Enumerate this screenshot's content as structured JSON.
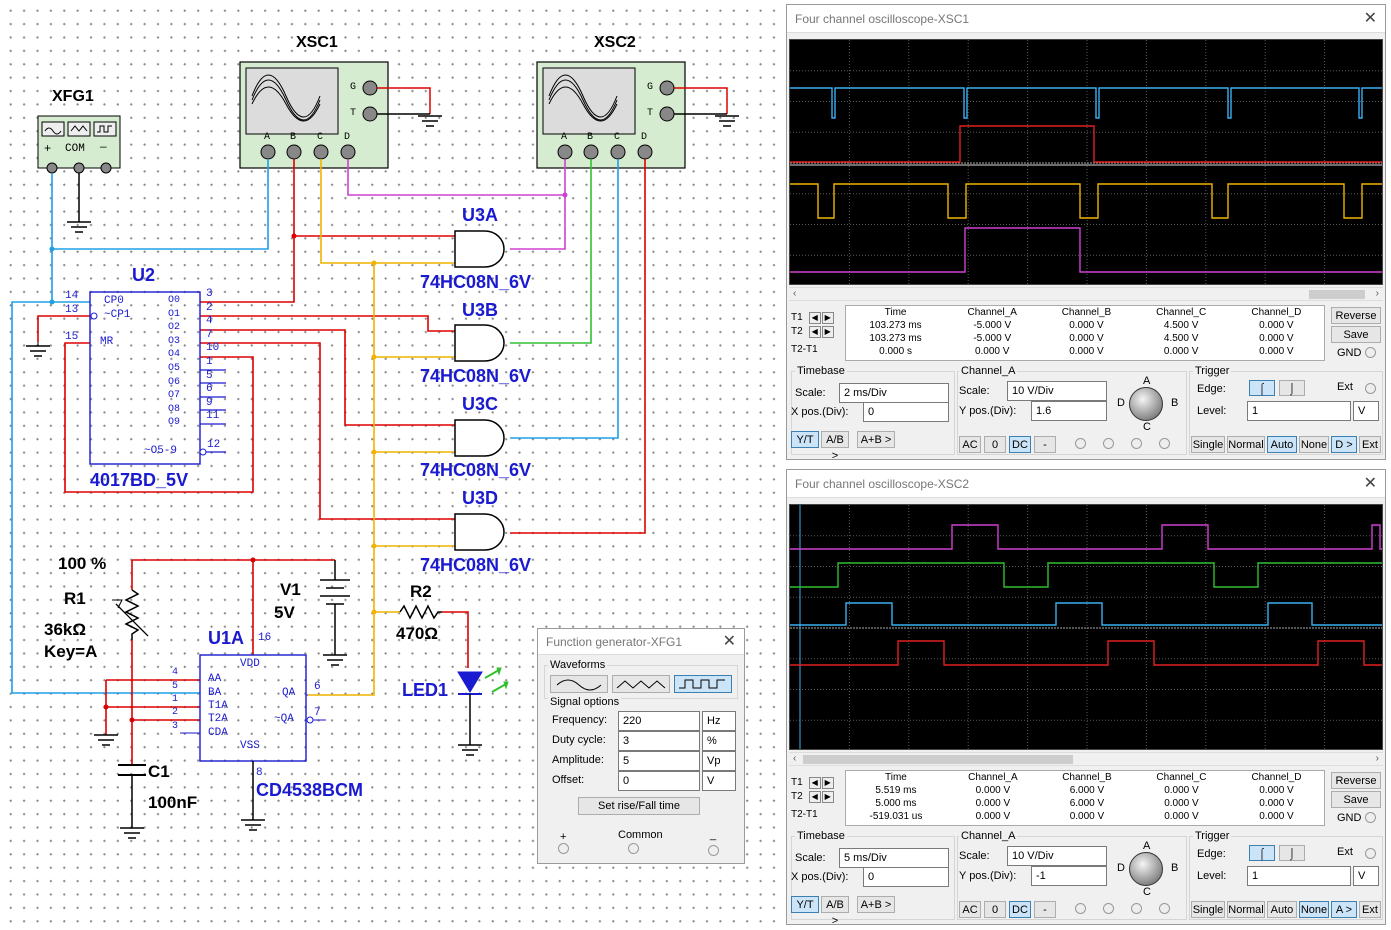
{
  "schematic": {
    "xfg1": "XFG1",
    "xfg_com": "COM",
    "xfg_plus": "+",
    "xfg_minus": "—",
    "xsc1": "XSC1",
    "xsc2": "XSC2",
    "scope_pins": [
      "A",
      "B",
      "C",
      "D"
    ],
    "scope_g": "G",
    "scope_t": "T",
    "u2": "U2",
    "u2_part": "4017BD_5V",
    "u2_pins_left": [
      "CP0",
      "~CP1",
      "MR"
    ],
    "u2_pin_nums_left": [
      "14",
      "13",
      "15"
    ],
    "u2_outputs": [
      "O0",
      "O1",
      "O2",
      "O3",
      "O4",
      "O5",
      "O6",
      "O7",
      "O8",
      "O9"
    ],
    "u2_output_nums": [
      "3",
      "2",
      "4",
      "7",
      "10",
      "1",
      "5",
      "6",
      "9",
      "11"
    ],
    "u2_o59": "~O5-9",
    "u2_o59_num": "12",
    "u3a": "U3A",
    "u3b": "U3B",
    "u3c": "U3C",
    "u3d": "U3D",
    "and_part": "74HC08N_6V",
    "r1_pct": "100 %",
    "r1": "R1",
    "r1_val": "36kΩ",
    "r1_key": "Key=A",
    "v1": "V1",
    "v1_val": "5V",
    "r2": "R2",
    "r2_val": "470Ω",
    "led1": "LED1",
    "u1a": "U1A",
    "u1_part": "CD4538BCM",
    "u1_pins_left": [
      "AA",
      "BA",
      "T1A",
      "T2A",
      "CDA"
    ],
    "u1_pin_nums_left": [
      "4",
      "5",
      "1",
      "2",
      "3"
    ],
    "u1_vdd": "VDD",
    "u1_vss": "VSS",
    "u1_vdd_num": "16",
    "u1_vss_num": "8",
    "u1_qa": "QA",
    "u1_nqa": "~QA",
    "u1_qa_num": "6",
    "u1_nqa_num": "7",
    "c1": "C1",
    "c1_val": "100nF"
  },
  "scope1": {
    "title": "Four channel oscilloscope-XSC1",
    "headers": [
      "",
      "Time",
      "Channel_A",
      "Channel_B",
      "Channel_C",
      "Channel_D"
    ],
    "rows": [
      [
        "T1",
        "103.273 ms",
        "-5.000 V",
        "0.000 V",
        "4.500 V",
        "0.000 V"
      ],
      [
        "T2",
        "103.273 ms",
        "-5.000 V",
        "0.000 V",
        "4.500 V",
        "0.000 V"
      ],
      [
        "T2-T1",
        "0.000 s",
        "0.000 V",
        "0.000 V",
        "0.000 V",
        "0.000 V"
      ]
    ],
    "timebase_title": "Timebase",
    "scale_label": "Scale:",
    "scale": "2 ms/Div",
    "xpos_label": "X pos.(Div):",
    "xpos": "0",
    "mode_buttons": [
      "Y/T",
      "A/B >",
      "A+B >"
    ],
    "channel_title": "Channel_A",
    "ch_scale": "10 V/Div",
    "ypos_label": "Y pos.(Div):",
    "ypos": "1.6",
    "coupling": [
      "AC",
      "0",
      "DC",
      "-"
    ],
    "knob_labels": [
      "A",
      "B",
      "C",
      "D"
    ],
    "trigger_title": "Trigger",
    "edge_label": "Edge:",
    "ext_label": "Ext",
    "level_label": "Level:",
    "level": "1",
    "level_unit": "V",
    "trig_buttons": [
      "Single",
      "Normal",
      "Auto",
      "None",
      "D >",
      "Ext"
    ],
    "reverse": "Reverse",
    "save": "Save",
    "gnd": "GND"
  },
  "scope2": {
    "title": "Four channel oscilloscope-XSC2",
    "headers": [
      "",
      "Time",
      "Channel_A",
      "Channel_B",
      "Channel_C",
      "Channel_D"
    ],
    "rows": [
      [
        "T1",
        "5.519 ms",
        "0.000 V",
        "6.000 V",
        "0.000 V",
        "0.000 V"
      ],
      [
        "T2",
        "5.000 ms",
        "0.000 V",
        "6.000 V",
        "0.000 V",
        "0.000 V"
      ],
      [
        "T2-T1",
        "-519.031 us",
        "0.000 V",
        "0.000 V",
        "0.000 V",
        "0.000 V"
      ]
    ],
    "timebase_title": "Timebase",
    "scale_label": "Scale:",
    "scale": "5 ms/Div",
    "xpos_label": "X pos.(Div):",
    "xpos": "0",
    "mode_buttons": [
      "Y/T",
      "A/B >",
      "A+B >"
    ],
    "channel_title": "Channel_A",
    "ch_scale": "10 V/Div",
    "ypos_label": "Y pos.(Div):",
    "ypos": "-1",
    "coupling": [
      "AC",
      "0",
      "DC",
      "-"
    ],
    "knob_labels": [
      "A",
      "B",
      "C",
      "D"
    ],
    "trigger_title": "Trigger",
    "edge_label": "Edge:",
    "ext_label": "Ext",
    "level_label": "Level:",
    "level": "1",
    "level_unit": "V",
    "trig_buttons": [
      "Single",
      "Normal",
      "Auto",
      "None",
      "A >",
      "Ext"
    ],
    "reverse": "Reverse",
    "save": "Save",
    "gnd": "GND"
  },
  "funcgen": {
    "title": "Function generator-XFG1",
    "waveforms_title": "Waveforms",
    "signal_title": "Signal options",
    "rows": [
      {
        "label": "Frequency:",
        "value": "220",
        "unit": "Hz"
      },
      {
        "label": "Duty cycle:",
        "value": "3",
        "unit": "%"
      },
      {
        "label": "Amplitude:",
        "value": "5",
        "unit": "Vp"
      },
      {
        "label": "Offset:",
        "value": "0",
        "unit": "V"
      }
    ],
    "rise_fall": "Set rise/Fall time",
    "plus": "+",
    "common": "Common",
    "minus": "_"
  },
  "colors": {
    "wire_red": "#dd0000",
    "wire_blue": "#1ea0e6",
    "wire_yellow": "#f0b400",
    "wire_magenta": "#d040d0",
    "wire_green": "#30c030",
    "text_blue": "#1a1ad0"
  }
}
